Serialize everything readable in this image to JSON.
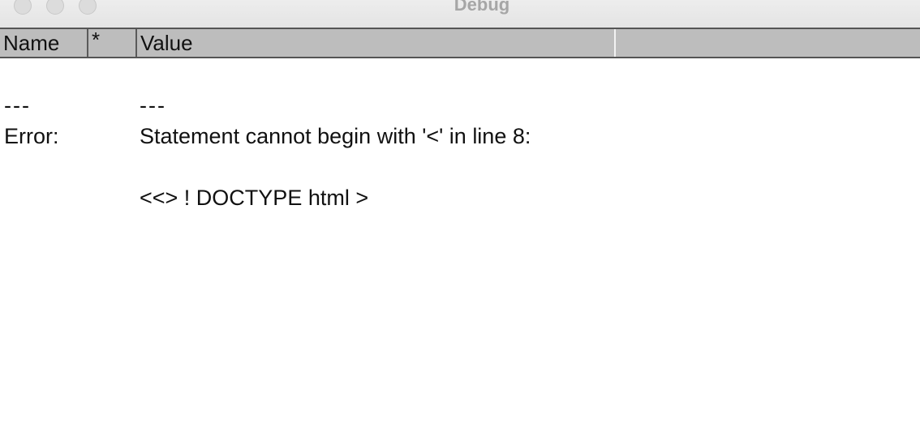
{
  "window": {
    "title": "Debug"
  },
  "table": {
    "columns": [
      "Name",
      "*",
      "Value",
      ""
    ]
  },
  "rows": [
    {
      "name": "---",
      "value": "---"
    },
    {
      "name": "Error:",
      "value": "Statement cannot begin with '<' in line 8:"
    },
    {
      "name": "",
      "value": "<<> ! DOCTYPE html >"
    }
  ]
}
